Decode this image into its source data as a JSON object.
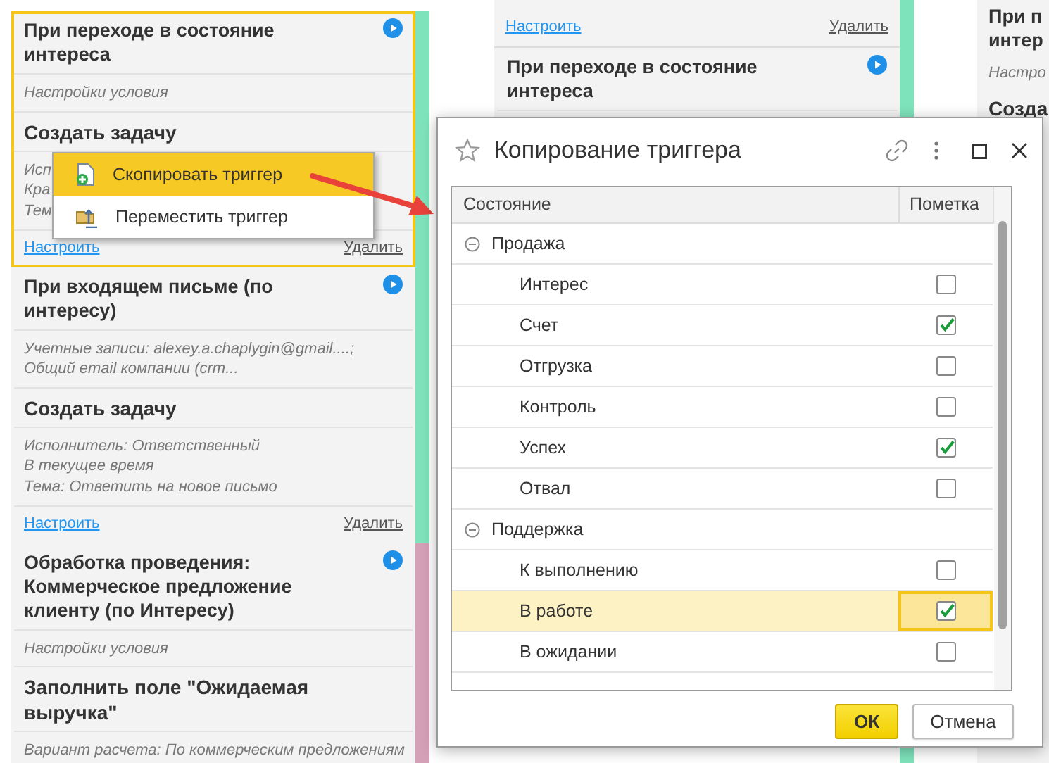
{
  "columns": [
    {
      "cards": [
        {
          "selected": true,
          "color": "#7ee3bb",
          "title": "При переходе в состояние интереса",
          "condition": [
            "Настройки условия"
          ],
          "action": "Создать задачу",
          "details": [
            "Исп",
            "Кра",
            "Тем"
          ],
          "configure_link": "Настроить",
          "delete_link": "Удалить"
        },
        {
          "selected": false,
          "color": "#7ee3bb",
          "title": "При входящем письме (по интересу)",
          "condition": [
            "Учетные записи: alexey.a.chaplygin@gmail....;",
            "Общий email компании (crm..."
          ],
          "action": "Создать задачу",
          "details": [
            "Исполнитель: Ответственный",
            "В текущее время",
            "Тема: Ответить на новое письмо"
          ],
          "configure_link": "Настроить",
          "delete_link": "Удалить"
        },
        {
          "selected": false,
          "color": "#d4a0b8",
          "title": "Обработка проведения: Коммерческое предложение клиенту (по Интересу)",
          "condition": [
            "Настройки условия"
          ],
          "action": "Заполнить поле \"Ожидаемая выручка\"",
          "details": [
            "Вариант расчета: По коммерческим предложениям"
          ]
        }
      ]
    },
    {
      "top_links": {
        "configure_link": "Настроить",
        "delete_link": "Удалить"
      },
      "cards": [
        {
          "selected": false,
          "color": "#7ee3bb",
          "title": "При переходе в состояние интереса"
        }
      ]
    },
    {
      "fragments": [
        "При п",
        "интер",
        "Настро",
        "Созда"
      ]
    }
  ],
  "context_menu": {
    "items": [
      {
        "label": "Скопировать триггер",
        "selected": true,
        "kind": "copy"
      },
      {
        "label": "Переместить триггер",
        "selected": false,
        "kind": "move"
      }
    ]
  },
  "dialog": {
    "title": "Копирование триггера",
    "table": {
      "columns": [
        "Состояние",
        "Пометка"
      ],
      "groups": [
        {
          "label": "Продажа",
          "expanded": true,
          "children": [
            {
              "label": "Интерес",
              "checked": false,
              "selected": false
            },
            {
              "label": "Счет",
              "checked": true,
              "selected": false
            },
            {
              "label": "Отгрузка",
              "checked": false,
              "selected": false
            },
            {
              "label": "Контроль",
              "checked": false,
              "selected": false
            },
            {
              "label": "Успех",
              "checked": true,
              "selected": false
            },
            {
              "label": "Отвал",
              "checked": false,
              "selected": false
            }
          ]
        },
        {
          "label": "Поддержка",
          "expanded": true,
          "children": [
            {
              "label": "К выполнению",
              "checked": false,
              "selected": false
            },
            {
              "label": "В работе",
              "checked": true,
              "selected": true
            },
            {
              "label": "В ожидании",
              "checked": false,
              "selected": false
            }
          ]
        }
      ]
    },
    "buttons": [
      {
        "label": "ОК",
        "kind": "primary"
      },
      {
        "label": "Отмена",
        "kind": "secondary"
      }
    ]
  }
}
